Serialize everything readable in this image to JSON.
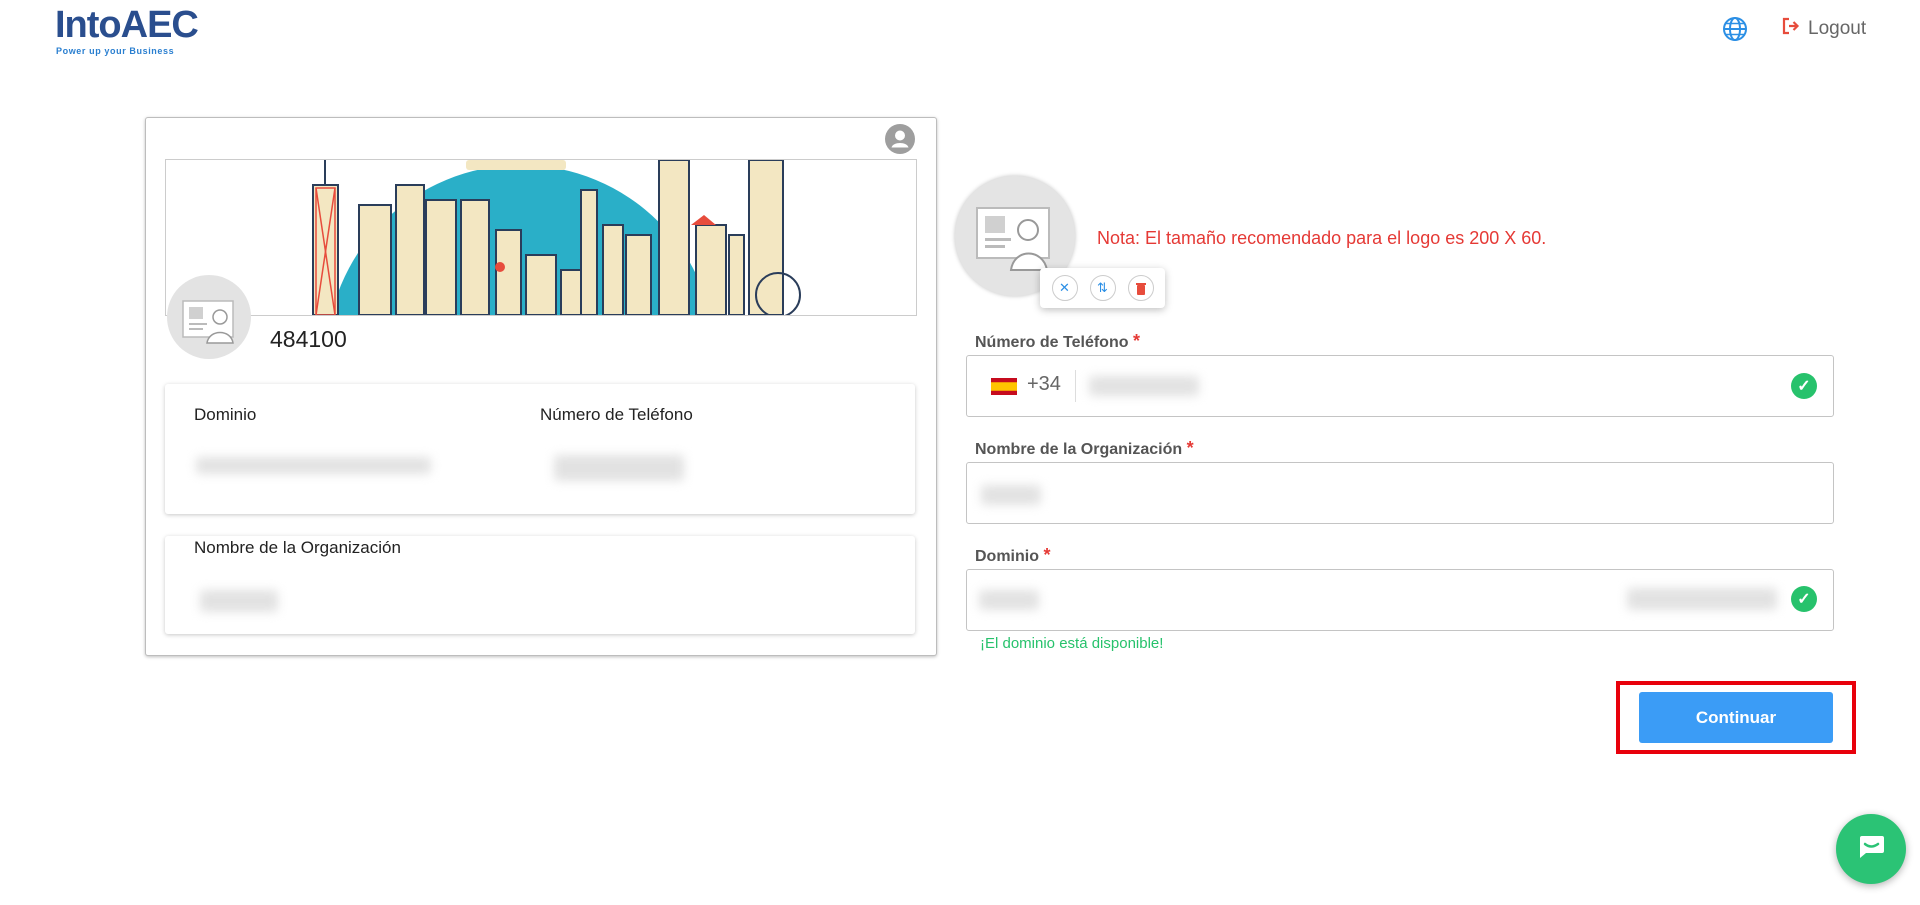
{
  "header": {
    "logo_text": "IntoAEC",
    "logo_tagline": "Power up your Business",
    "language_icon": "globe-icon",
    "logout_icon": "logout-icon",
    "logout_label": "Logout"
  },
  "preview_card": {
    "profile_icon": "user-circle-icon",
    "id_number": "484100",
    "domain_label": "Dominio",
    "phone_label": "Número de Teléfono",
    "org_label": "Nombre de la Organización"
  },
  "form": {
    "note": "Nota: El tamaño recomendado para el logo es 200 X 60.",
    "phone": {
      "label": "Número de Teléfono",
      "required_mark": "*",
      "country_code": "+34",
      "country_flag": "spain-flag-icon"
    },
    "organization": {
      "label": "Nombre de la Organización",
      "required_mark": "*"
    },
    "domain": {
      "label": "Dominio",
      "required_mark": "*",
      "availability_message": "¡El dominio está disponible!"
    },
    "continue_label": "Continuar"
  },
  "colors": {
    "accent": "#3b9cf6",
    "success": "#27c26c",
    "error": "#e53935",
    "highlight": "#e8000b",
    "logo": "#2a4e8e"
  }
}
